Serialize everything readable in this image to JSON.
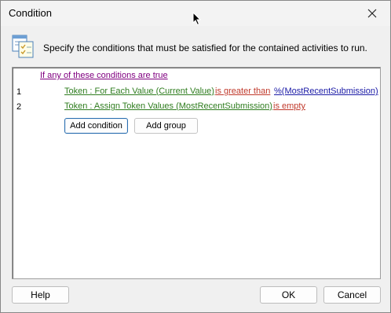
{
  "window": {
    "title": "Condition"
  },
  "header": {
    "description": "Specify the conditions that must be satisfied for the contained activities to run."
  },
  "conditions": {
    "group_label": "If any of these conditions are true",
    "rows": [
      {
        "number": "1",
        "field": "Token : For Each Value (Current Value)",
        "operator": "is greater than",
        "value": "%(MostRecentSubmission)"
      },
      {
        "number": "2",
        "field": "Token : Assign Token Values (MostRecentSubmission)",
        "operator": "is empty",
        "value": ""
      }
    ],
    "add_condition_label": "Add condition",
    "add_group_label": "Add group"
  },
  "footer": {
    "help_label": "Help",
    "ok_label": "OK",
    "cancel_label": "Cancel"
  },
  "icons": {
    "close": "close-icon",
    "header": "conditions-list-icon",
    "cursor": "mouse-pointer-icon"
  }
}
